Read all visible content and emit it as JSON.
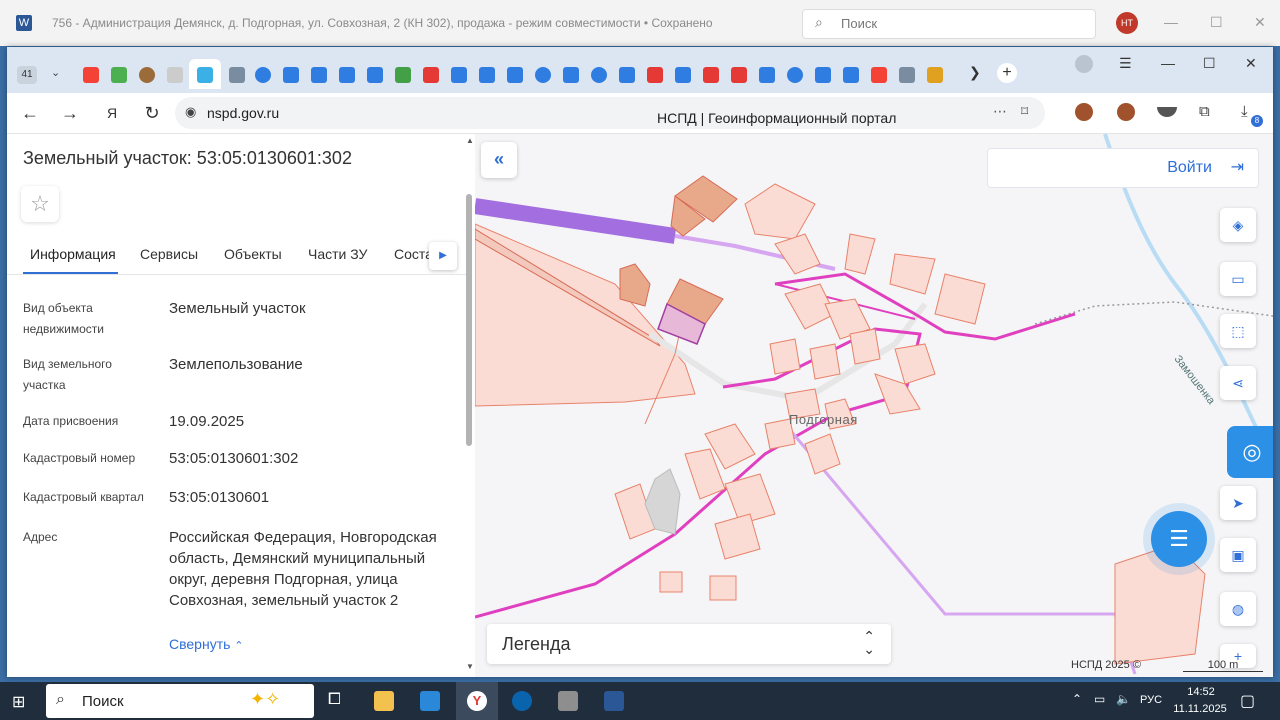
{
  "word": {
    "title": "756 - Администрация Демянск, д. Подгорная, ул. Совхозная, 2  (КН 302), продажа  -  режим совместимости  •  Сохранено",
    "search_placeholder": "Поиск",
    "avatar": "НТ"
  },
  "browser": {
    "tab_count": "41",
    "url": "nspd.gov.ru",
    "page_title": "НСПД | Геоинформационный портал",
    "downloads_badge": "8"
  },
  "panel": {
    "title": "Земельный участок: 53:05:0130601:302",
    "tabs": [
      "Информация",
      "Сервисы",
      "Объекты",
      "Части ЗУ",
      "Соста"
    ],
    "fields": [
      {
        "label": "Вид объекта недвижимости",
        "value": "Земельный участок"
      },
      {
        "label": "Вид земельного участка",
        "value": "Землепользование"
      },
      {
        "label": "Дата присвоения",
        "value": "19.09.2025"
      },
      {
        "label": "Кадастровый номер",
        "value": "53:05:0130601:302"
      },
      {
        "label": "Кадастровый квартал",
        "value": "53:05:0130601"
      },
      {
        "label": "Адрес",
        "value": "Российская Федерация, Новгородская область, Демянский муниципальный округ, деревня Подгорная, улица Совхозная, земельный участок 2"
      }
    ],
    "collapse_label": "Свернуть"
  },
  "map": {
    "login_label": "Войти",
    "legend_label": "Легенда",
    "place_label": "Подгорная",
    "river_label": "Замошенка",
    "copyright": "НСПД 2025 ©",
    "scale": "100 m",
    "colors": {
      "parcel_fill": "#fbdcd4",
      "parcel_stroke": "#e8826a",
      "road": "#e040c0",
      "accent": "#2f6fd6"
    }
  },
  "taskbar": {
    "search_placeholder": "Поиск",
    "lang": "РУС",
    "time": "14:52",
    "date": "11.11.2025"
  }
}
